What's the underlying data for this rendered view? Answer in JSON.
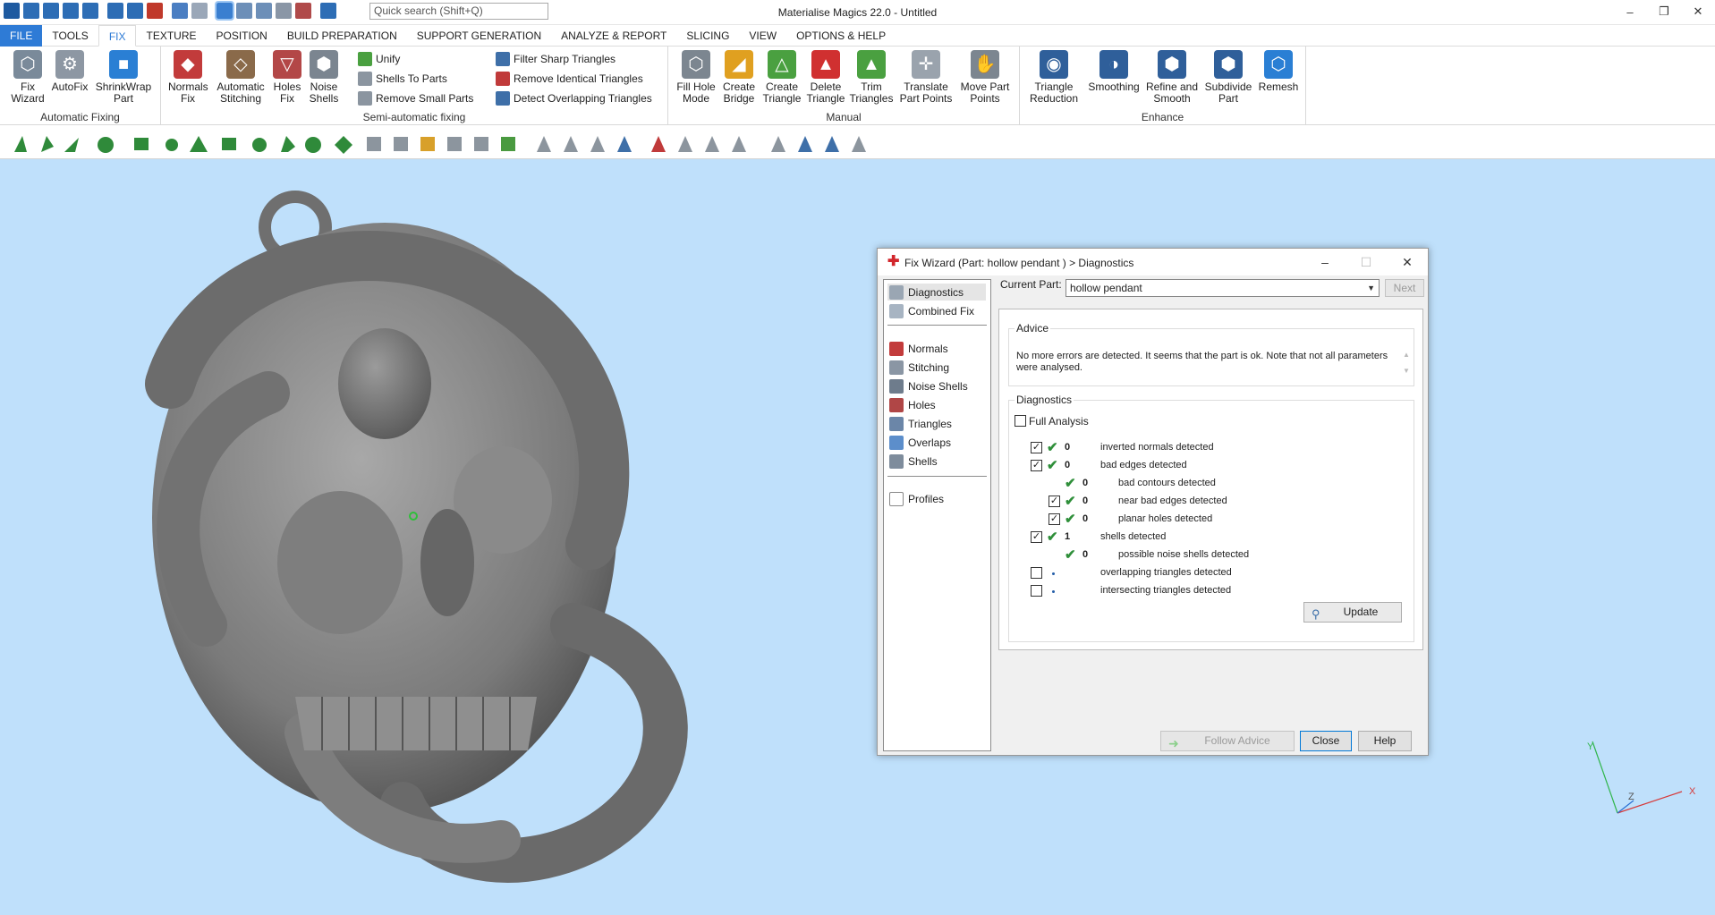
{
  "app": {
    "title": "Materialise Magics 22.0 - Untitled",
    "search_placeholder": "Quick search (Shift+Q)",
    "window_controls": [
      "–",
      "❐",
      "✕"
    ]
  },
  "menu": [
    "FILE",
    "TOOLS",
    "FIX",
    "TEXTURE",
    "POSITION",
    "BUILD PREPARATION",
    "SUPPORT GENERATION",
    "ANALYZE & REPORT",
    "SLICING",
    "VIEW",
    "OPTIONS & HELP"
  ],
  "ribbon": {
    "automatic_fixing": {
      "label": "Automatic Fixing",
      "buttons": [
        "Fix\nWizard",
        "AutoFix",
        "ShrinkWrap\nPart"
      ]
    },
    "semi_automatic": {
      "label": "Semi-automatic fixing",
      "big_buttons": [
        "Normals\nFix",
        "Automatic\nStitching",
        "Holes\nFix",
        "Noise\nShells"
      ],
      "small_buttons": [
        "Unify",
        "Shells To Parts",
        "Remove Small Parts",
        "Filter Sharp Triangles",
        "Remove Identical Triangles",
        "Detect Overlapping Triangles"
      ]
    },
    "manual": {
      "label": "Manual",
      "buttons": [
        "Fill Hole\nMode",
        "Create\nBridge",
        "Create\nTriangle",
        "Delete\nTriangle",
        "Trim\nTriangles",
        "Translate\nPart Points",
        "Move Part\nPoints"
      ]
    },
    "enhance": {
      "label": "Enhance",
      "buttons": [
        "Triangle\nReduction",
        "Smoothing",
        "Refine and\nSmooth",
        "Subdivide\nPart",
        "Remesh"
      ]
    }
  },
  "dialog": {
    "title": "Fix Wizard (Part: hollow pendant  ) > Diagnostics",
    "nav_top": [
      "Diagnostics",
      "Combined Fix"
    ],
    "nav_mid": [
      "Normals",
      "Stitching",
      "Noise Shells",
      "Holes",
      "Triangles",
      "Overlaps",
      "Shells"
    ],
    "nav_bottom": [
      "Profiles"
    ],
    "current_part_label": "Current Part:",
    "current_part_value": "hollow pendant",
    "next_label": "Next",
    "advice_legend": "Advice",
    "advice_text": "No more errors are detected. It seems that the part is ok. Note that not all parameters were analysed.",
    "diagnostics_legend": "Diagnostics",
    "full_analysis_label": "Full Analysis",
    "rows": [
      {
        "checked": true,
        "ok": true,
        "count": "0",
        "text": "inverted normals detected",
        "indent": 0,
        "checkbox": true
      },
      {
        "checked": true,
        "ok": true,
        "count": "0",
        "text": "bad edges detected",
        "indent": 0,
        "checkbox": true
      },
      {
        "checked": false,
        "ok": true,
        "count": "0",
        "text": "bad contours detected",
        "indent": 1,
        "checkbox": false
      },
      {
        "checked": true,
        "ok": true,
        "count": "0",
        "text": "near bad edges detected",
        "indent": 1,
        "checkbox": true
      },
      {
        "checked": true,
        "ok": true,
        "count": "0",
        "text": "planar holes detected",
        "indent": 1,
        "checkbox": true
      },
      {
        "checked": true,
        "ok": true,
        "count": "1",
        "text": "shells detected",
        "indent": 0,
        "checkbox": true
      },
      {
        "checked": false,
        "ok": true,
        "count": "0",
        "text": "possible noise shells detected",
        "indent": 1,
        "checkbox": false
      },
      {
        "checked": false,
        "ok": false,
        "count": "",
        "text": "overlapping triangles detected",
        "indent": 0,
        "checkbox": true
      },
      {
        "checked": false,
        "ok": false,
        "count": "",
        "text": "intersecting triangles detected",
        "indent": 0,
        "checkbox": true
      }
    ],
    "update_label": "Update",
    "follow_advice_label": "Follow Advice",
    "close_label": "Close",
    "help_label": "Help"
  },
  "axes": {
    "y": "Y",
    "z": "Z",
    "x": "X"
  }
}
